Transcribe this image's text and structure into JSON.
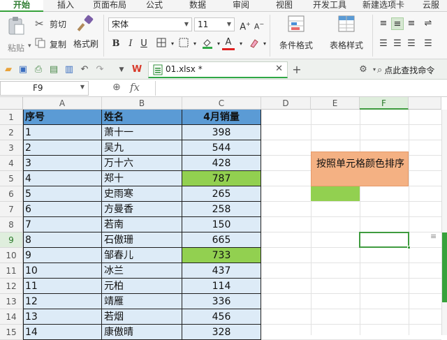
{
  "ribbon_tabs": [
    {
      "label": "开始",
      "active": true
    },
    {
      "label": "插入"
    },
    {
      "label": "页面布局"
    },
    {
      "label": "公式"
    },
    {
      "label": "数据"
    },
    {
      "label": "审阅"
    },
    {
      "label": "视图"
    },
    {
      "label": "开发工具"
    },
    {
      "label": "新建选项卡"
    },
    {
      "label": "云服"
    }
  ],
  "clipboard": {
    "paste": "粘贴",
    "cut": "剪切",
    "copy": "复制",
    "format_painter": "格式刷"
  },
  "font": {
    "name": "宋体",
    "size": "11",
    "bold": "B",
    "italic": "I",
    "underline": "U",
    "font_color": "A"
  },
  "styles": {
    "conditional_format": "条件格式",
    "table_style": "表格样式"
  },
  "document": {
    "tab_name": "01.xlsx *",
    "find_command": "点此查找命令"
  },
  "formula_bar": {
    "name_box": "F9",
    "fx": "fx",
    "formula": ""
  },
  "columns": [
    "A",
    "B",
    "C",
    "D",
    "E",
    "F"
  ],
  "selected_column": "F",
  "rows": [
    "1",
    "2",
    "3",
    "4",
    "5",
    "6",
    "7",
    "8",
    "9",
    "10",
    "11",
    "12",
    "13",
    "14",
    "15"
  ],
  "selected_row": "9",
  "table": {
    "headers": [
      "序号",
      "姓名",
      "4月销量"
    ],
    "rows": [
      [
        "1",
        "萧十一",
        "398"
      ],
      [
        "2",
        "吴九",
        "544"
      ],
      [
        "3",
        "万十六",
        "428"
      ],
      [
        "4",
        "郑十",
        "787"
      ],
      [
        "5",
        "史雨寒",
        "265"
      ],
      [
        "6",
        "方曼香",
        "258"
      ],
      [
        "7",
        "若南",
        "150"
      ],
      [
        "8",
        "石傲珊",
        "665"
      ],
      [
        "9",
        "邹春儿",
        "733"
      ],
      [
        "10",
        "冰兰",
        "437"
      ],
      [
        "11",
        "元柏",
        "114"
      ],
      [
        "12",
        "靖雁",
        "336"
      ],
      [
        "13",
        "若烟",
        "456"
      ],
      [
        "14",
        "康傲晴",
        "328"
      ]
    ],
    "highlighted_rows": [
      3,
      8
    ]
  },
  "note": {
    "text": "按照单元格颜色排序"
  },
  "colors": {
    "header_blue": "#5b9bd5",
    "row_blue": "#ddebf7",
    "green_fill": "#92d050",
    "note_orange": "#f4b183",
    "active_tab_green": "#2fa845"
  }
}
